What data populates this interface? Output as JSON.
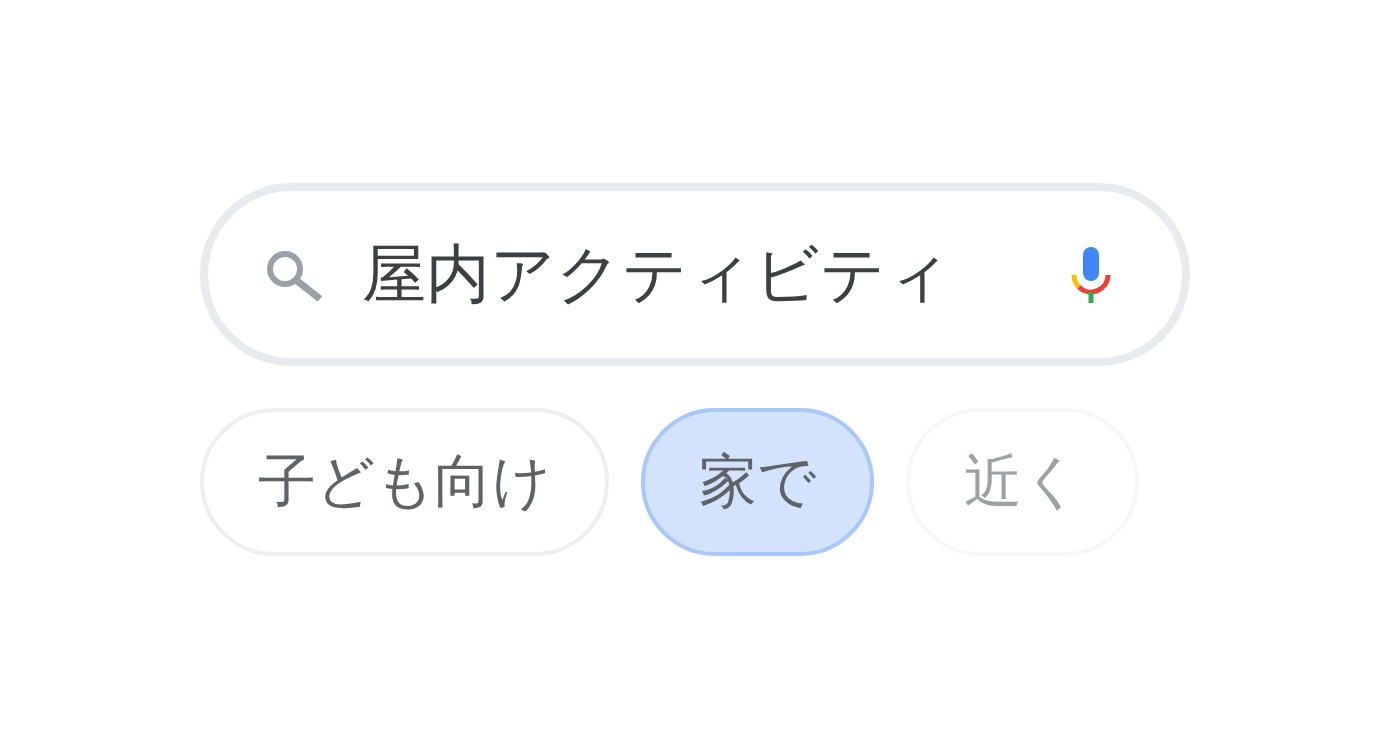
{
  "search": {
    "query": "屋内アクティビティ"
  },
  "chips": [
    {
      "label": "子ども向け",
      "selected": false,
      "faded": false
    },
    {
      "label": "家で",
      "selected": true,
      "faded": false
    },
    {
      "label": "近く",
      "selected": false,
      "faded": true
    }
  ]
}
